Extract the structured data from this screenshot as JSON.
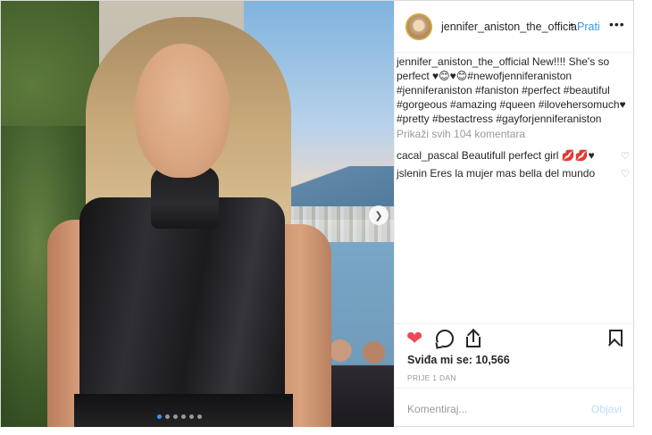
{
  "post": {
    "username": "jennifer_aniston_the_officia",
    "separator": "•",
    "follow_label": "Prati",
    "more_icon": "ellipsis-icon"
  },
  "caption": {
    "author": "jennifer_aniston_the_official",
    "text": " New!!!! She's so perfect ♥😊♥😊#newofjenniferaniston #jenniferaniston #faniston #perfect #beautiful #gorgeous #amazing #queen #ilovehersomuch♥ #pretty #bestactress #gayforjenniferaniston"
  },
  "view_all_comments": "Prikaži svih 104 komentara",
  "comments": [
    {
      "user": "cacal_pascal",
      "text": "Beautifull perfect girl 💋💋♥"
    },
    {
      "user": "jslenin",
      "text": "Eres la mujer mas bella del mundo"
    }
  ],
  "actions": {
    "like_icon": "heart-filled-icon",
    "comment_icon": "comment-bubble-icon",
    "share_icon": "share-upload-icon",
    "save_icon": "bookmark-icon"
  },
  "likes_text": "Sviđa mi se: 10,566",
  "timestamp": "PRIJE 1 DAN",
  "add_comment": {
    "placeholder": "Komentiraj...",
    "post_label": "Objavi"
  },
  "carousel": {
    "dot_count": 6,
    "active_index": 0
  },
  "colors": {
    "accent": "#3897f0",
    "like": "#ed4956",
    "muted": "#999999",
    "post_disabled": "#b2dffc"
  }
}
